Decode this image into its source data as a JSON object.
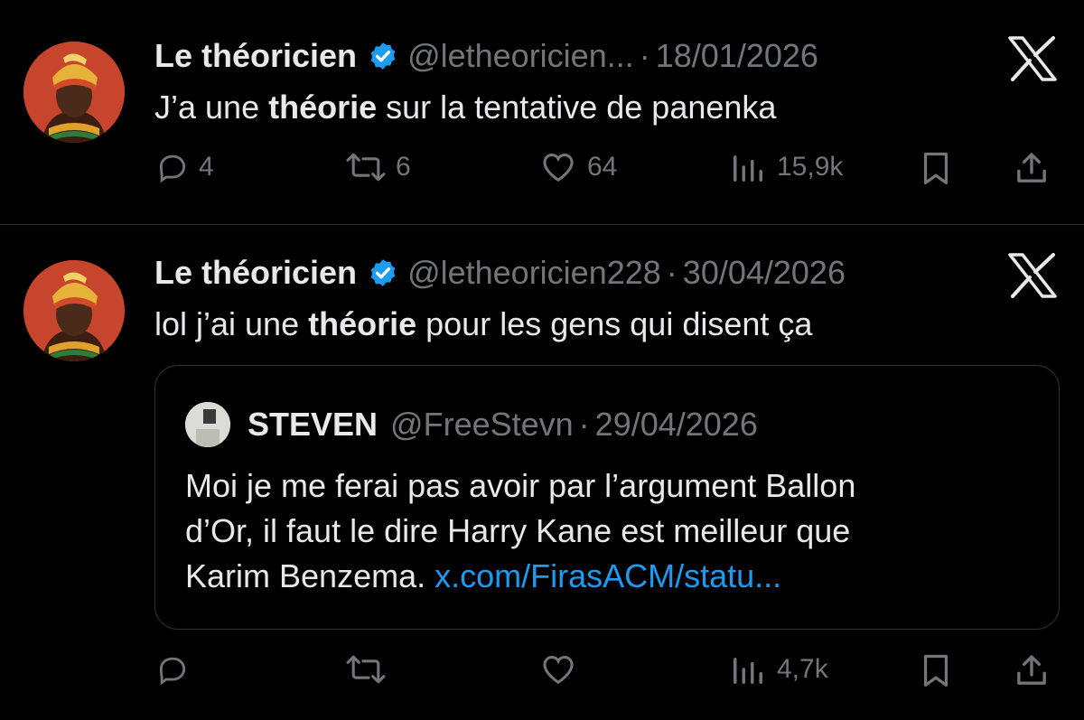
{
  "colors": {
    "background": "#000000",
    "text": "#e7e9ea",
    "muted": "#71767b",
    "link": "#1d9bf0",
    "verified": "#1d9bf0"
  },
  "tweets": [
    {
      "author_name": "Le théoricien",
      "handle": "@letheoricien...",
      "separator": "·",
      "date": "18/01/2026",
      "text_before": "J’a une ",
      "text_bold": "théorie",
      "text_after": " sur la tentative de panenka",
      "actions": {
        "replies": "4",
        "reposts": "6",
        "likes": "64",
        "views": "15,9k"
      }
    },
    {
      "author_name": "Le théoricien",
      "handle": "@letheoricien228",
      "separator": "·",
      "date": "30/04/2026",
      "text_before": "lol j’ai une ",
      "text_bold": "théorie",
      "text_after": " pour les gens qui disent ça",
      "quote": {
        "author_name": "STEVEN",
        "handle": "@FreeStevn",
        "separator": "·",
        "date": "29/04/2026",
        "line1": "Moi je me ferai pas avoir par l’argument Ballon",
        "line2": "d’Or, il faut le dire Harry Kane est meilleur que",
        "line3": "Karim Benzema. ",
        "link": "x.com/FirasACM/statu..."
      },
      "actions": {
        "views": "4,7k"
      }
    }
  ]
}
